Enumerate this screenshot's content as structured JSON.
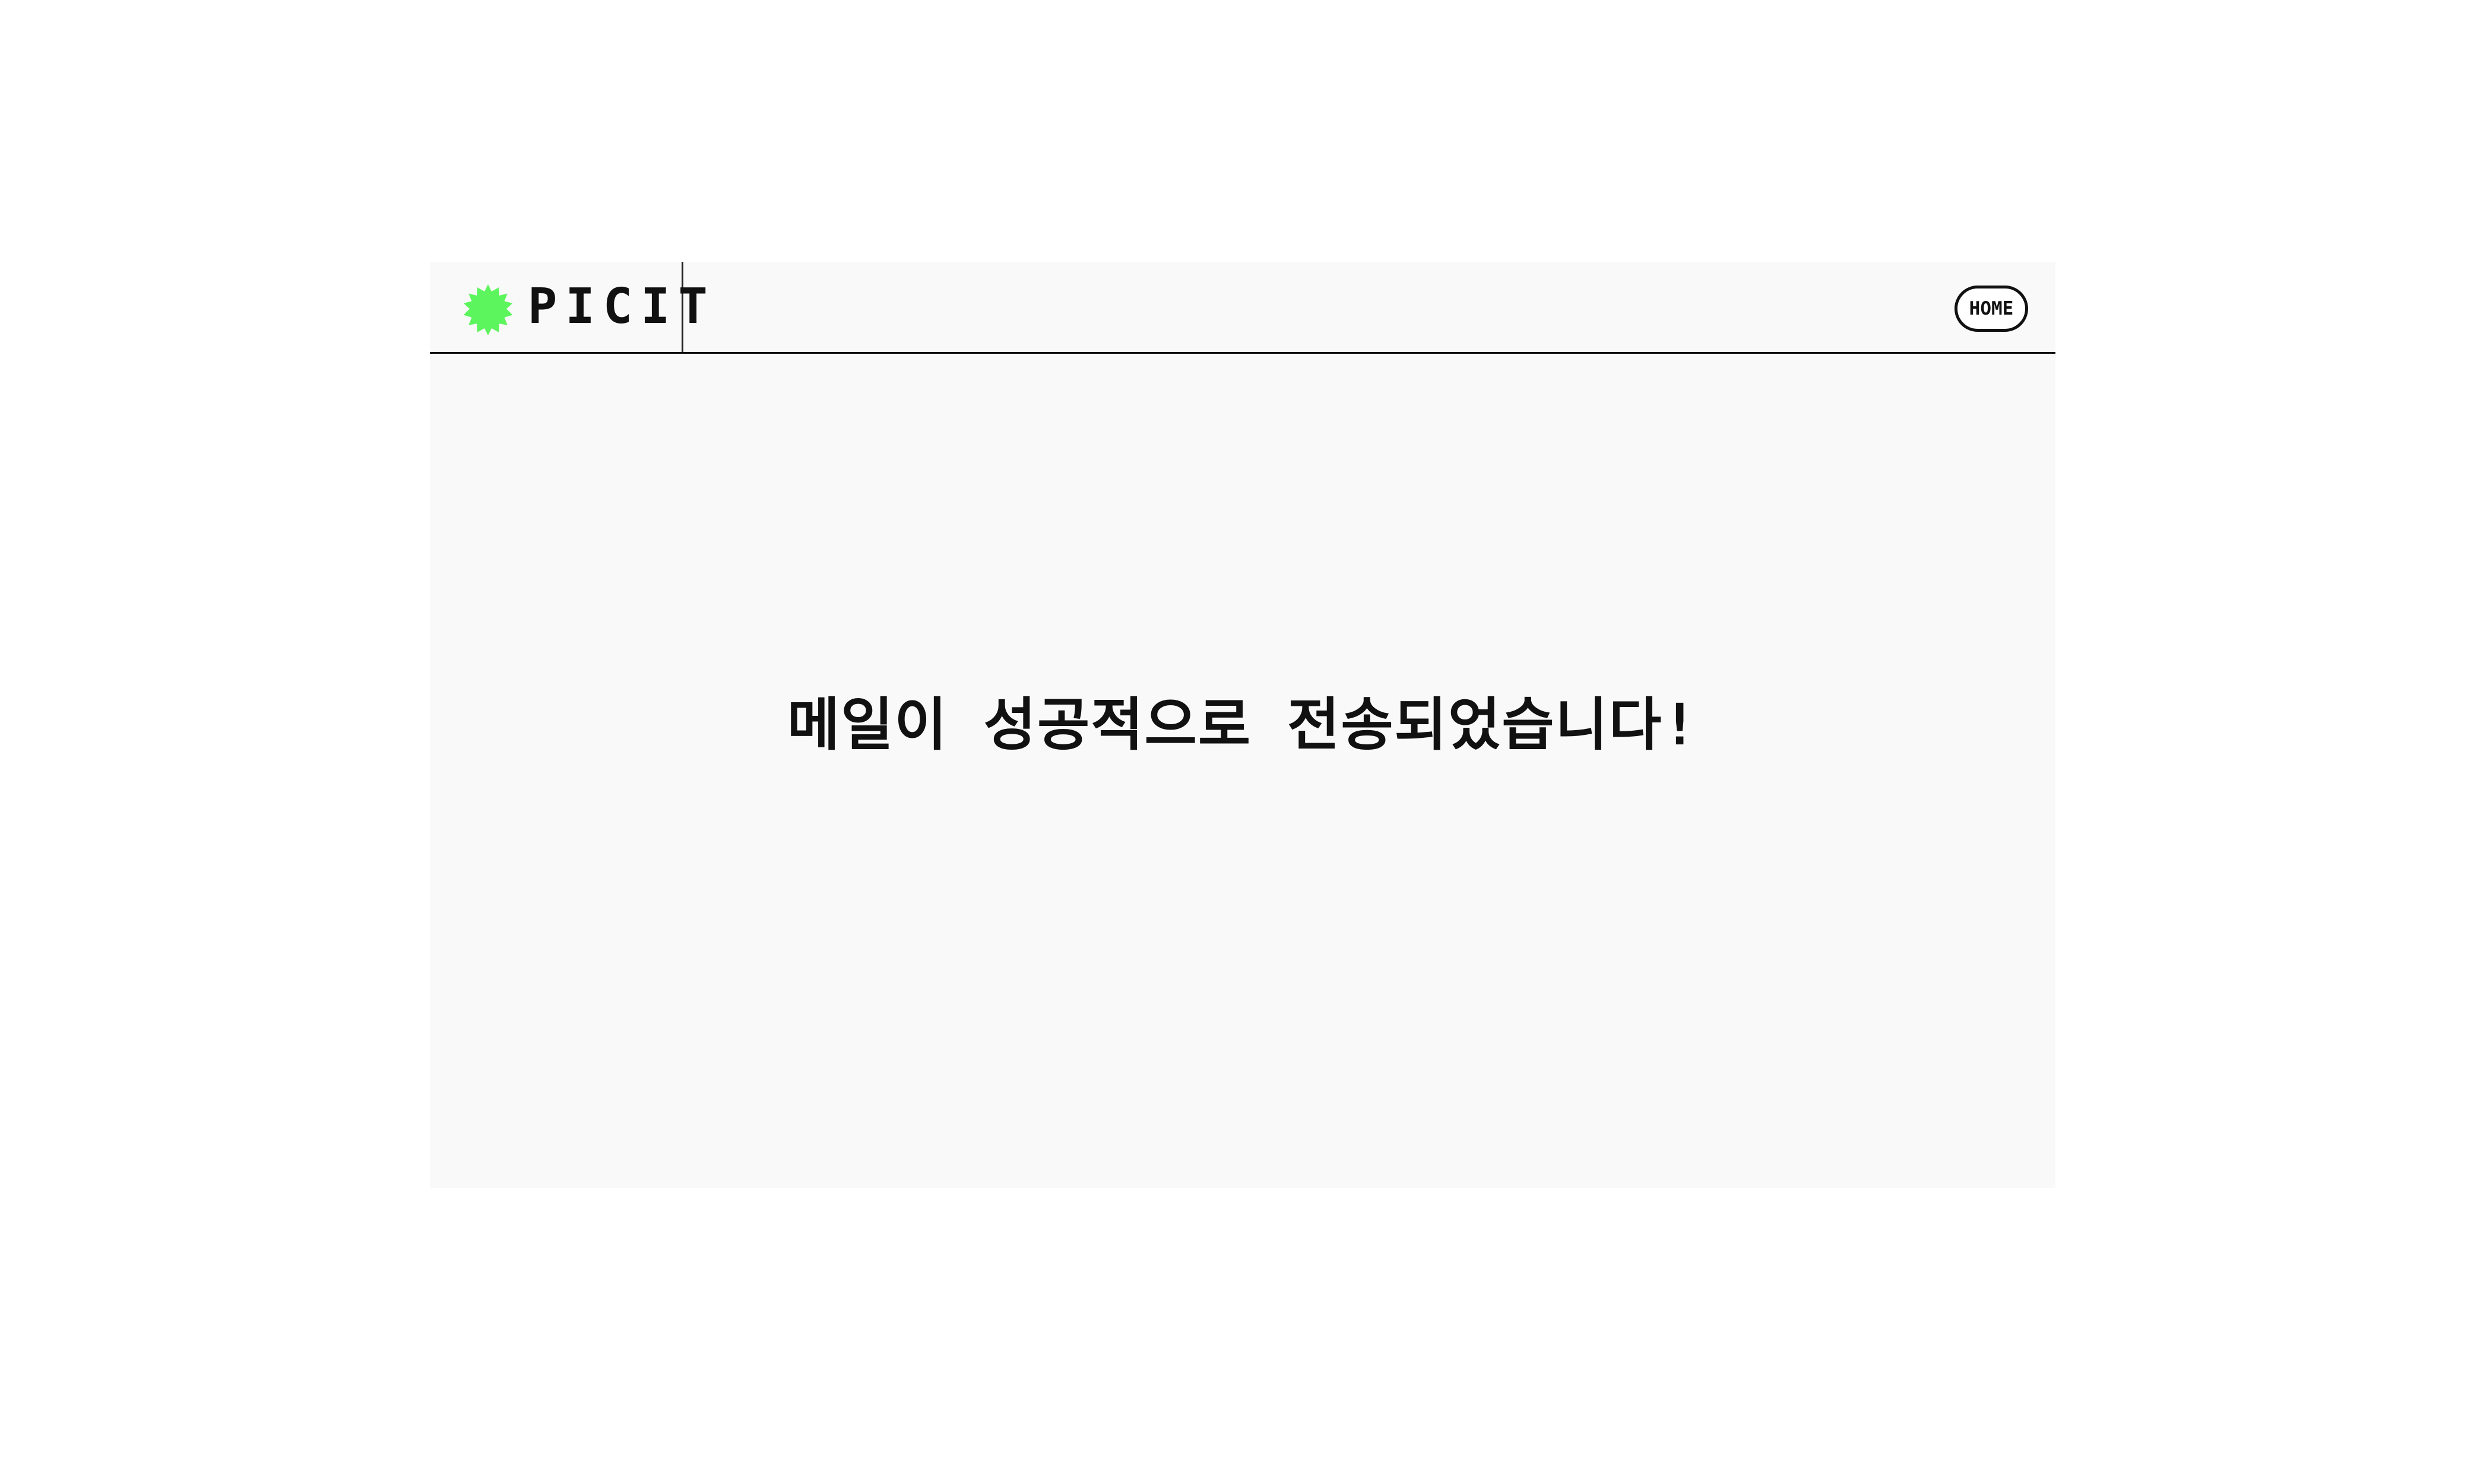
{
  "header": {
    "brand_name": "PICIT",
    "logo_icon": "green-burst-icon",
    "home_label": "HOME"
  },
  "main": {
    "message": "메일이 성공적으로 전송되었습니다!"
  },
  "colors": {
    "background": "#ffffff",
    "panel": "#f9f9f9",
    "accent": "#5df55d",
    "text": "#111111"
  }
}
